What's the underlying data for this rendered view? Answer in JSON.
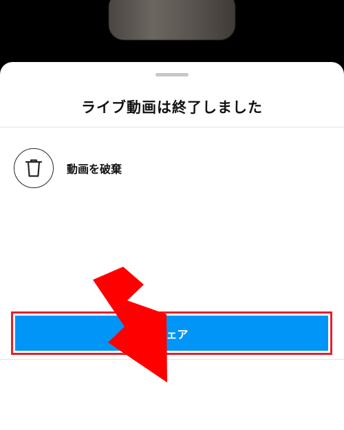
{
  "sheet": {
    "title": "ライブ動画は終了しました",
    "discard_label": "動画を破棄",
    "discard_icon": "trash-icon",
    "share_label": "シェア"
  },
  "colors": {
    "share_button": "#0095f6",
    "highlight": "#e4202a",
    "arrow": "#ff0000"
  }
}
